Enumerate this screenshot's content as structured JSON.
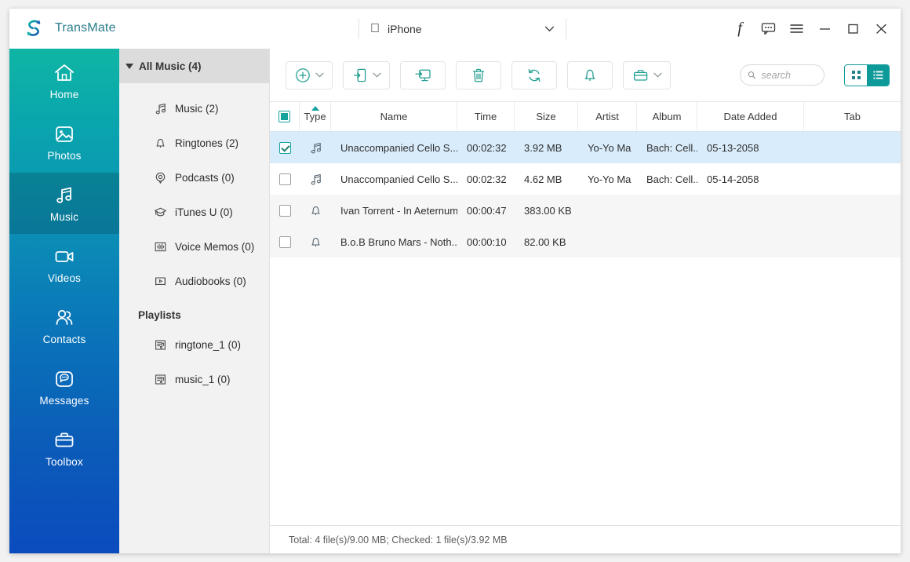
{
  "app": {
    "brand": "TransMate",
    "logo_icon": "refresh-s-logo"
  },
  "titlebar": {
    "device": {
      "platform_icon": "apple-icon",
      "name": "iPhone",
      "chevron_icon": "chevron-down-icon"
    },
    "buttons": [
      {
        "name": "facebook-button",
        "label": "f",
        "icon": "facebook-icon"
      },
      {
        "name": "feedback-button",
        "label": "",
        "icon": "message-bubble-icon"
      },
      {
        "name": "menu-button",
        "label": "",
        "icon": "hamburger-menu-icon"
      },
      {
        "name": "minimize-button",
        "label": "",
        "icon": "minimize-icon"
      },
      {
        "name": "maximize-button",
        "label": "",
        "icon": "maximize-icon"
      },
      {
        "name": "close-button",
        "label": "",
        "icon": "close-icon"
      }
    ]
  },
  "sidebar": {
    "active": "Music",
    "items": [
      {
        "label": "Home",
        "icon": "home-icon"
      },
      {
        "label": "Photos",
        "icon": "photos-icon"
      },
      {
        "label": "Music",
        "icon": "music-note-icon"
      },
      {
        "label": "Videos",
        "icon": "video-camera-icon"
      },
      {
        "label": "Contacts",
        "icon": "contacts-icon"
      },
      {
        "label": "Messages",
        "icon": "messages-icon"
      },
      {
        "label": "Toolbox",
        "icon": "toolbox-icon"
      }
    ]
  },
  "categories": {
    "header": "All Music (4)",
    "header_icon": "triangle-down-icon",
    "items": [
      {
        "label": "Music (2)",
        "icon": "music-note-icon"
      },
      {
        "label": "Ringtones (2)",
        "icon": "bell-icon"
      },
      {
        "label": "Podcasts (0)",
        "icon": "podcast-icon"
      },
      {
        "label": "iTunes U (0)",
        "icon": "graduation-cap-icon"
      },
      {
        "label": "Voice Memos (0)",
        "icon": "waveform-icon"
      },
      {
        "label": "Audiobooks (0)",
        "icon": "audiobook-icon"
      }
    ],
    "playlists_header": "Playlists",
    "playlists": [
      {
        "label": "ringtone_1 (0)",
        "icon": "playlist-icon"
      },
      {
        "label": "music_1 (0)",
        "icon": "playlist-icon"
      }
    ]
  },
  "toolbar": {
    "buttons": [
      {
        "name": "add-button",
        "icon": "plus-circle-icon",
        "has_dropdown": true
      },
      {
        "name": "export-to-device-button",
        "icon": "export-to-phone-icon",
        "has_dropdown": true
      },
      {
        "name": "export-to-pc-button",
        "icon": "export-to-monitor-icon",
        "has_dropdown": false
      },
      {
        "name": "delete-button",
        "icon": "trash-icon",
        "has_dropdown": false
      },
      {
        "name": "refresh-button",
        "icon": "refresh-icon",
        "has_dropdown": false
      },
      {
        "name": "ringtone-maker-button",
        "icon": "bell-icon",
        "has_dropdown": false
      },
      {
        "name": "toolbox-button",
        "icon": "toolbox-icon",
        "has_dropdown": true
      }
    ],
    "search": {
      "placeholder": "search",
      "value": "",
      "icon": "search-icon"
    },
    "view_toggle": {
      "grid_icon": "grid-view-icon",
      "list_icon": "list-view-icon",
      "active": "list"
    }
  },
  "table": {
    "columns": [
      "Type",
      "Name",
      "Time",
      "Size",
      "Artist",
      "Album",
      "Date Added",
      "Tab"
    ],
    "sort_column": "Type",
    "sort_direction": "asc",
    "header_checkbox_state": "indeterminate",
    "rows": [
      {
        "checked": true,
        "type_icon": "music-note-icon",
        "name": "Unaccompanied Cello S...",
        "time": "00:02:32",
        "size": "3.92 MB",
        "artist": "Yo-Yo Ma",
        "album": "Bach: Cell...",
        "date_added": "05-13-2058",
        "tab": ""
      },
      {
        "checked": false,
        "type_icon": "music-note-icon",
        "name": "Unaccompanied Cello S...",
        "time": "00:02:32",
        "size": "4.62 MB",
        "artist": "Yo-Yo Ma",
        "album": "Bach: Cell...",
        "date_added": "05-14-2058",
        "tab": ""
      },
      {
        "checked": false,
        "type_icon": "bell-icon",
        "name": "Ivan Torrent - In Aeternum",
        "time": "00:00:47",
        "size": "383.00 KB",
        "artist": "",
        "album": "",
        "date_added": "",
        "tab": ""
      },
      {
        "checked": false,
        "type_icon": "bell-icon",
        "name": "B.o.B Bruno Mars - Noth...",
        "time": "00:00:10",
        "size": "82.00 KB",
        "artist": "",
        "album": "",
        "date_added": "",
        "tab": ""
      }
    ]
  },
  "statusbar": {
    "text": "Total: 4 file(s)/9.00 MB; Checked: 1 file(s)/3.92 MB"
  },
  "colors": {
    "accent_teal": "#0f9a9a",
    "brand_text": "#2a7d8c",
    "selected_row": "#d9ecfb",
    "sidebar_top": "#0fb5a4",
    "sidebar_bottom": "#0b4bbe"
  }
}
